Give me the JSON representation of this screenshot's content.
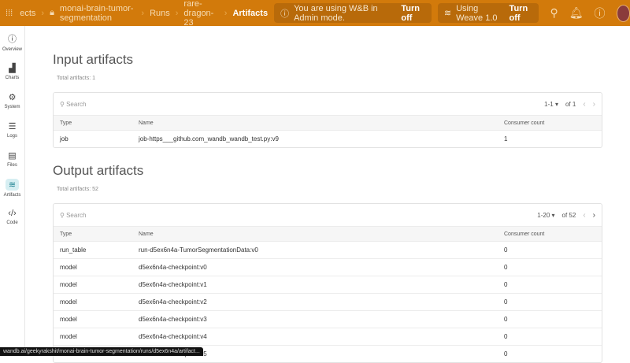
{
  "topbar": {
    "breadcrumb": [
      "ects",
      "monai-brain-tumor-segmentation",
      "Runs",
      "rare-dragon-23",
      "Artifacts"
    ],
    "admin_notice": "You are using W&B in Admin mode.",
    "admin_turn_off": "Turn off",
    "weave_notice": "Using Weave 1.0",
    "weave_turn_off": "Turn off",
    "brand_color": "#d27a0b"
  },
  "sidebar": {
    "items": [
      {
        "label": "Overview",
        "icon": "info-icon"
      },
      {
        "label": "Charts",
        "icon": "chart-icon"
      },
      {
        "label": "System",
        "icon": "gear-icon"
      },
      {
        "label": "Logs",
        "icon": "list-icon"
      },
      {
        "label": "Files",
        "icon": "file-icon"
      },
      {
        "label": "Artifacts",
        "icon": "layers-icon",
        "active": true
      },
      {
        "label": "Code",
        "icon": "code-icon"
      }
    ]
  },
  "input": {
    "title": "Input artifacts",
    "total": "Total artifacts: 1",
    "search_placeholder": "Search",
    "page_range": "1-1",
    "page_of": "of 1",
    "columns": [
      "Type",
      "Name",
      "Consumer count"
    ],
    "rows": [
      [
        "job",
        "job-https___github.com_wandb_wandb_test.py:v9",
        "1"
      ]
    ]
  },
  "output": {
    "title": "Output artifacts",
    "total": "Total artifacts: 52",
    "search_placeholder": "Search",
    "page_range": "1-20",
    "page_of": "of 52",
    "columns": [
      "Type",
      "Name",
      "Consumer count"
    ],
    "rows": [
      [
        "run_table",
        "run-d5ex6n4a-TumorSegmentationData:v0",
        "0"
      ],
      [
        "model",
        "d5ex6n4a-checkpoint:v0",
        "0"
      ],
      [
        "model",
        "d5ex6n4a-checkpoint:v1",
        "0"
      ],
      [
        "model",
        "d5ex6n4a-checkpoint:v2",
        "0"
      ],
      [
        "model",
        "d5ex6n4a-checkpoint:v3",
        "0"
      ],
      [
        "model",
        "d5ex6n4a-checkpoint:v4",
        "0"
      ],
      [
        "model",
        "d5ex6n4a-checkpoint:v5",
        "0"
      ]
    ]
  },
  "status_url": "wandb.ai/geekyrakshit/monai-brain-tumor-segmentation/runs/d5ex6n4a/artifact..."
}
